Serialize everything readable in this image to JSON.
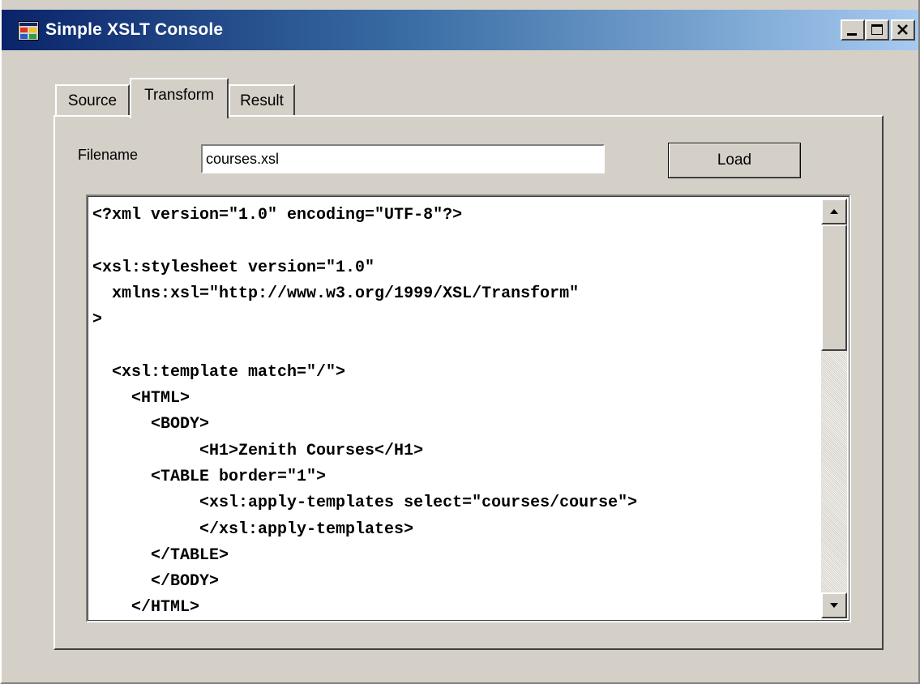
{
  "window": {
    "title": "Simple XSLT Console",
    "controls": {
      "minimize": "minimize-icon",
      "maximize": "maximize-icon",
      "close": "close-icon"
    }
  },
  "tabs": [
    {
      "label": "Source",
      "selected": false
    },
    {
      "label": "Transform",
      "selected": true
    },
    {
      "label": "Result",
      "selected": false
    }
  ],
  "transform": {
    "filename_label": "Filename",
    "filename_value": "courses.xsl",
    "load_label": "Load",
    "code": "<?xml version=\"1.0\" encoding=\"UTF-8\"?>\n\n<xsl:stylesheet version=\"1.0\"\n  xmlns:xsl=\"http://www.w3.org/1999/XSL/Transform\"\n>\n\n  <xsl:template match=\"/\">\n    <HTML>\n      <BODY>\n           <H1>Zenith Courses</H1>\n      <TABLE border=\"1\">\n           <xsl:apply-templates select=\"courses/course\">\n           </xsl:apply-templates>\n      </TABLE>\n      </BODY>\n    </HTML>"
  },
  "scrollbar": {
    "up_icon": "scroll-up-arrow-icon",
    "down_icon": "scroll-down-arrow-icon",
    "scroll_position": 0
  },
  "colors": {
    "titlebar_start": "#0a246a",
    "titlebar_end": "#a6caf0",
    "face": "#d4d0c8"
  }
}
